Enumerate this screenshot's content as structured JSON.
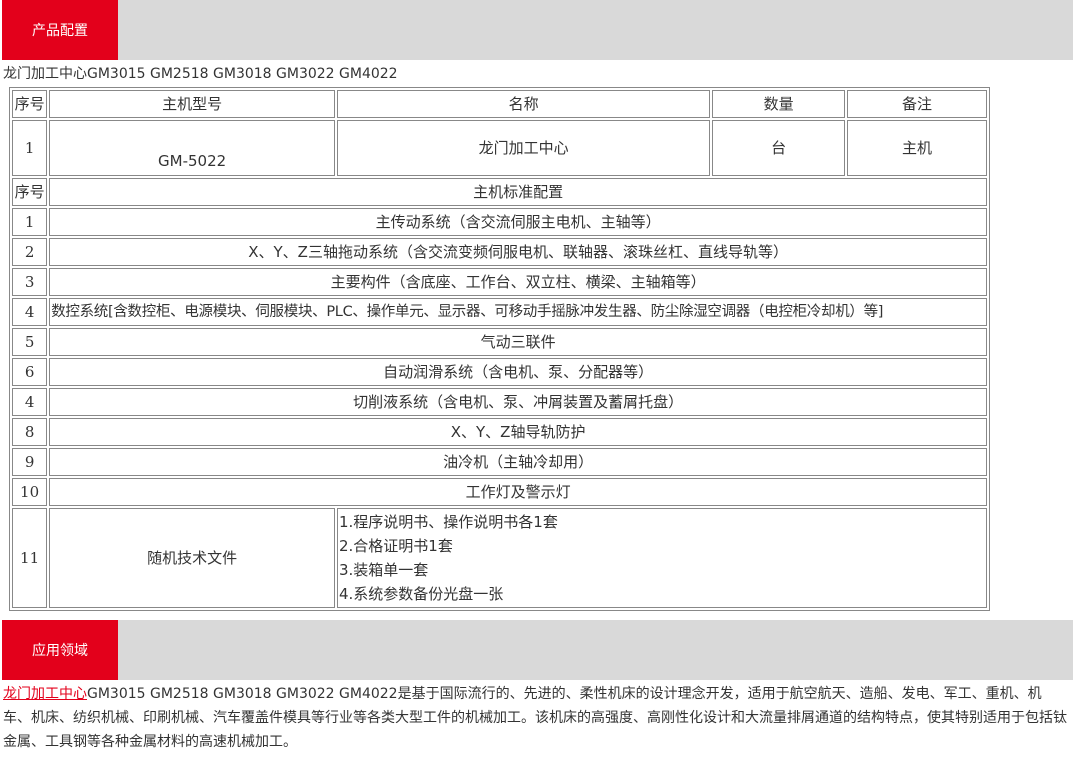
{
  "config_section": {
    "title": "产品配置"
  },
  "product_line": "龙门加工中心GM3015 GM2518 GM3018 GM3022 GM4022",
  "table": {
    "header": {
      "no": "序号",
      "model": "主机型号",
      "name": "名称",
      "qty": "数量",
      "remark": "备注"
    },
    "main_row": {
      "no": "1",
      "model": "GM-5022",
      "name": "龙门加工中心",
      "qty": "台",
      "remark": "主机"
    },
    "std_header": {
      "no": "序号",
      "title": "主机标准配置"
    },
    "std_items": [
      {
        "no": "1",
        "text": "主传动系统（含交流伺服主电机、主轴等）"
      },
      {
        "no": "2",
        "text": "X、Y、Z三轴拖动系统（含交流变频伺服电机、联轴器、滚珠丝杠、直线导轨等）"
      },
      {
        "no": "3",
        "text": "主要构件（含底座、工作台、双立柱、横梁、主轴箱等）"
      },
      {
        "no": "4",
        "text": "数控系统[含数控柜、电源模块、伺服模块、PLC、操作单元、显示器、可移动手摇脉冲发生器、防尘除湿空调器（电控柜冷却机）等]"
      },
      {
        "no": "5",
        "text": "气动三联件"
      },
      {
        "no": "6",
        "text": "自动润滑系统（含电机、泵、分配器等）"
      },
      {
        "no": "4",
        "text": "切削液系统（含电机、泵、冲屑装置及蓄屑托盘）"
      },
      {
        "no": "8",
        "text": "X、Y、Z轴导轨防护"
      },
      {
        "no": "9",
        "text": "油冷机（主轴冷却用）"
      },
      {
        "no": "10",
        "text": "工作灯及警示灯"
      }
    ],
    "docs_row": {
      "no": "11",
      "label": "随机技术文件",
      "items": [
        "1.程序说明书、操作说明书各1套",
        "2.合格证明书1套",
        "3.装箱单一套",
        "4.系统参数备份光盘一张"
      ]
    }
  },
  "application_section": {
    "title": "应用领域"
  },
  "description": {
    "link_text": "龙门加工中心",
    "text": "GM3015 GM2518 GM3018 GM3022 GM4022是基于国际流行的、先进的、柔性机床的设计理念开发，适用于航空航天、造船、发电、军工、重机、机车、机床、纺织机械、印刷机械、汽车覆盖件模具等行业等各类大型工件的机械加工。该机床的高强度、高刚性化设计和大流量排屑通道的结构特点，使其特别适用于包括钛金属、工具钢等各种金属材料的高速机械加工。"
  },
  "colors": {
    "accent": "#e3001b",
    "bar": "#d9d9d9",
    "border": "#888888",
    "text": "#333333"
  }
}
